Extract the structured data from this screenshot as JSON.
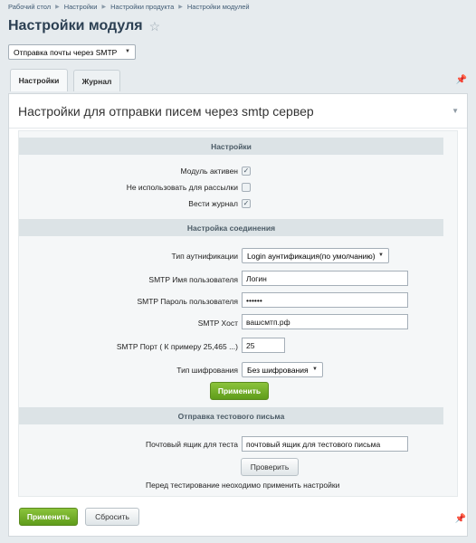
{
  "breadcrumb": [
    "Рабочий стол",
    "Настройки",
    "Настройки продукта",
    "Настройки модулей"
  ],
  "page": {
    "title": "Настройки модуля",
    "star_icon": "star-icon"
  },
  "module_select": {
    "value": "Отправка почты через SMTP"
  },
  "tabs": [
    {
      "label": "Настройки"
    },
    {
      "label": "Журнал"
    }
  ],
  "panel": {
    "title": "Настройки для отправки писем через smtp сервер"
  },
  "sections": {
    "settings": {
      "title": "Настройки",
      "module_active_label": "Модуль активен",
      "module_active_checked": true,
      "no_mailing_label": "Не использовать для рассылки",
      "no_mailing_checked": false,
      "log_label": "Вести журнал",
      "log_checked": true
    },
    "connection": {
      "title": "Настройка соединения",
      "auth_label": "Тип аутнификации",
      "auth_value": "Login аунтификация(по умолчанию)",
      "user_label": "SMTP Имя пользователя",
      "user_value": "Логин",
      "password_label": "SMTP Пароль пользователя",
      "password_value": "••••••",
      "host_label": "SMTP Хост",
      "host_value": "вашсмтп.рф",
      "port_label": "SMTP Порт ( К примеру 25,465 ...)",
      "port_value": "25",
      "encryption_label": "Тип шифрования",
      "encryption_value": "Без шифрования",
      "apply_label": "Применить"
    },
    "test": {
      "title": "Отправка тестового письма",
      "mailbox_label": "Почтовый ящик для теста",
      "mailbox_value": "почтовый ящик для тестового письма",
      "check_label": "Проверить",
      "note": "Перед тестирование неоходимо применить настройки"
    }
  },
  "footer": {
    "apply_label": "Применить",
    "reset_label": "Сбросить"
  },
  "colors": {
    "accent_green": "#6aa823",
    "header_bg": "#dce3e6",
    "page_bg": "#e6ebee"
  }
}
